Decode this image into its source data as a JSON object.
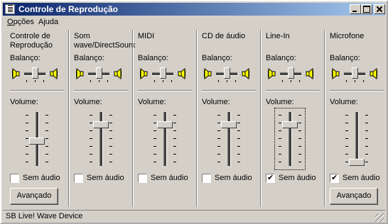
{
  "window": {
    "title": "Controle de Reprodução"
  },
  "menu": [
    {
      "label": "Opções",
      "accesskey_index": 0
    },
    {
      "label": "Ajuda",
      "accesskey_index": 1
    }
  ],
  "labels": {
    "balance": "Balanço:",
    "volume": "Volume:",
    "mute": "Sem áudio",
    "advanced": "Avançado"
  },
  "channels": [
    {
      "name": "Controle de Reprodução",
      "volume_level": 0.45,
      "balance": 0.0,
      "muted": false,
      "has_advanced": true,
      "focused": false
    },
    {
      "name": "Som wave/DirectSound",
      "volume_level": 0.8,
      "balance": 0.0,
      "muted": false,
      "has_advanced": false,
      "focused": false
    },
    {
      "name": "MIDI",
      "volume_level": 0.8,
      "balance": 0.0,
      "muted": false,
      "has_advanced": false,
      "focused": false
    },
    {
      "name": "CD de áudio",
      "volume_level": 0.8,
      "balance": 0.0,
      "muted": false,
      "has_advanced": false,
      "focused": false
    },
    {
      "name": "Line-In",
      "volume_level": 0.8,
      "balance": 0.0,
      "muted": true,
      "has_advanced": false,
      "focused": true
    },
    {
      "name": "Microfone",
      "volume_level": 0.0,
      "balance": 0.0,
      "muted": true,
      "has_advanced": true,
      "focused": false
    }
  ],
  "status": {
    "text": "SB Live! Wave Device"
  },
  "icons": {
    "app": "mixer-app-icon",
    "speaker_left": "speaker-left-icon",
    "speaker_right": "speaker-right-icon"
  }
}
